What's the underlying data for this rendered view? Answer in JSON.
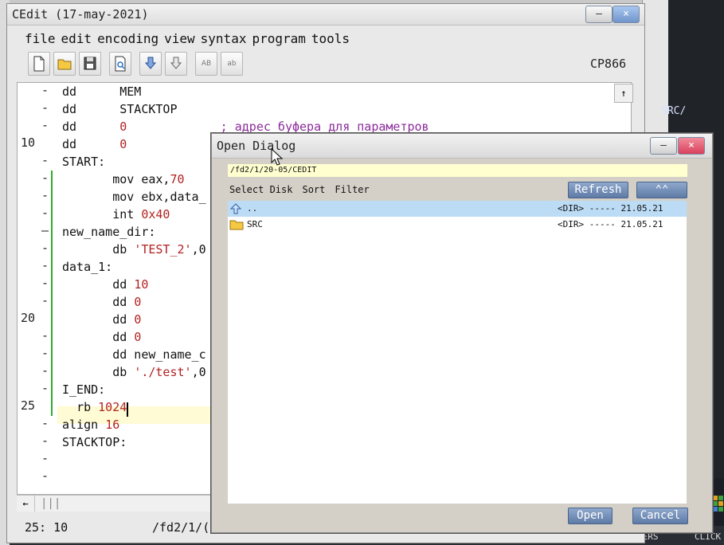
{
  "editor_window": {
    "title": "CEdit (17-may-2021)",
    "menu": [
      "file",
      "edit",
      "encoding",
      "view",
      "syntax",
      "program",
      "tools"
    ],
    "toolbar": {
      "buttons": [
        "new-file-icon",
        "open-folder-icon",
        "save-icon",
        "print-preview-icon",
        "move-down-icon",
        "move-out-icon"
      ],
      "upper_label": "AB",
      "lower_label": "ab"
    },
    "encoding": "CP866",
    "minimize": "–",
    "close": "×",
    "scroll_up": "↑",
    "scroll_left": "←",
    "hscroll_grip": "|||",
    "status": {
      "position": "25: 10",
      "path": "/fd2/1/("
    },
    "gutter": [
      {
        "num": "",
        "mark": "-"
      },
      {
        "num": "",
        "mark": "-"
      },
      {
        "num": "",
        "mark": "-"
      },
      {
        "num": "10",
        "mark": ""
      },
      {
        "num": "",
        "mark": "-"
      },
      {
        "num": "",
        "mark": "-"
      },
      {
        "num": "",
        "mark": "-"
      },
      {
        "num": "",
        "mark": "-"
      },
      {
        "num": "",
        "mark": "—"
      },
      {
        "num": "",
        "mark": "-"
      },
      {
        "num": "",
        "mark": "-"
      },
      {
        "num": "",
        "mark": "-"
      },
      {
        "num": "",
        "mark": "-"
      },
      {
        "num": "20",
        "mark": ""
      },
      {
        "num": "",
        "mark": "-"
      },
      {
        "num": "",
        "mark": "-"
      },
      {
        "num": "",
        "mark": "-"
      },
      {
        "num": "",
        "mark": "-"
      },
      {
        "num": "25",
        "mark": ""
      },
      {
        "num": "",
        "mark": "-"
      },
      {
        "num": "",
        "mark": "-"
      },
      {
        "num": "",
        "mark": "-"
      },
      {
        "num": "",
        "mark": "-"
      }
    ],
    "lines": [
      {
        "p1": "dd",
        "gap": "      ",
        "p2": "MEM"
      },
      {
        "p1": "dd",
        "gap": "      ",
        "p2": "STACKTOP"
      },
      {
        "p1": "dd",
        "gap": "      ",
        "num": "0",
        "comment": "             ; адрес буфера для параметров"
      },
      {
        "p1": "dd",
        "gap": "      ",
        "num": "0"
      },
      {
        "label": "START:"
      },
      {
        "indent": "       ",
        "p1": "mov eax,",
        "num": "70"
      },
      {
        "indent": "       ",
        "p1": "mov ebx,data_"
      },
      {
        "indent": "       ",
        "p1": "int ",
        "num": "0x40"
      },
      {
        "label": "new_name_dir:"
      },
      {
        "indent": "       ",
        "p1": "db ",
        "str": "'TEST_2'",
        "tail": ",0"
      },
      {
        "label": "data_1:"
      },
      {
        "indent": "       ",
        "p1": "dd ",
        "num": "10"
      },
      {
        "indent": "       ",
        "p1": "dd ",
        "num": "0"
      },
      {
        "indent": "       ",
        "p1": "dd ",
        "num": "0"
      },
      {
        "indent": "       ",
        "p1": "dd ",
        "num": "0"
      },
      {
        "indent": "       ",
        "p1": "dd new_name_c"
      },
      {
        "indent": "       ",
        "p1": "db ",
        "str": "'./test'",
        "tail": ",0"
      },
      {
        "label": "I_END:"
      },
      {
        "indent": "  ",
        "p1": "rb ",
        "num": "1024"
      },
      {
        "p1": "align ",
        "num": "16"
      },
      {
        "label": "STACKTOP:"
      }
    ]
  },
  "open_dialog": {
    "title": "Open Dialog",
    "minimize": "–",
    "close": "×",
    "path": "/fd2/1/20-05/CEDIT",
    "options": [
      "Select Disk",
      "Sort",
      "Filter"
    ],
    "refresh": "Refresh",
    "up_button": "⌃⌃",
    "files": [
      {
        "name": "..",
        "info": "<DIR> ----- 21.05.21",
        "icon": "up-arrow-icon",
        "selected": true
      },
      {
        "name": "SRC",
        "info": "<DIR> ----- 21.05.21",
        "icon": "folder-icon",
        "selected": false
      }
    ],
    "open": "Open",
    "cancel": "Cancel"
  },
  "background": {
    "right_text": "SRC/",
    "bottom_left": "KERS",
    "bottom_right": "CLICK"
  },
  "colors": {
    "selection": "#bcdcf6",
    "path_bg": "#ffffd0",
    "dialog_button": "#6f8bb5",
    "number_color": "#b22222",
    "comment_color": "#8b2b9a",
    "current_line": "#fffbd4",
    "change_bar": "#2eaa2e"
  }
}
